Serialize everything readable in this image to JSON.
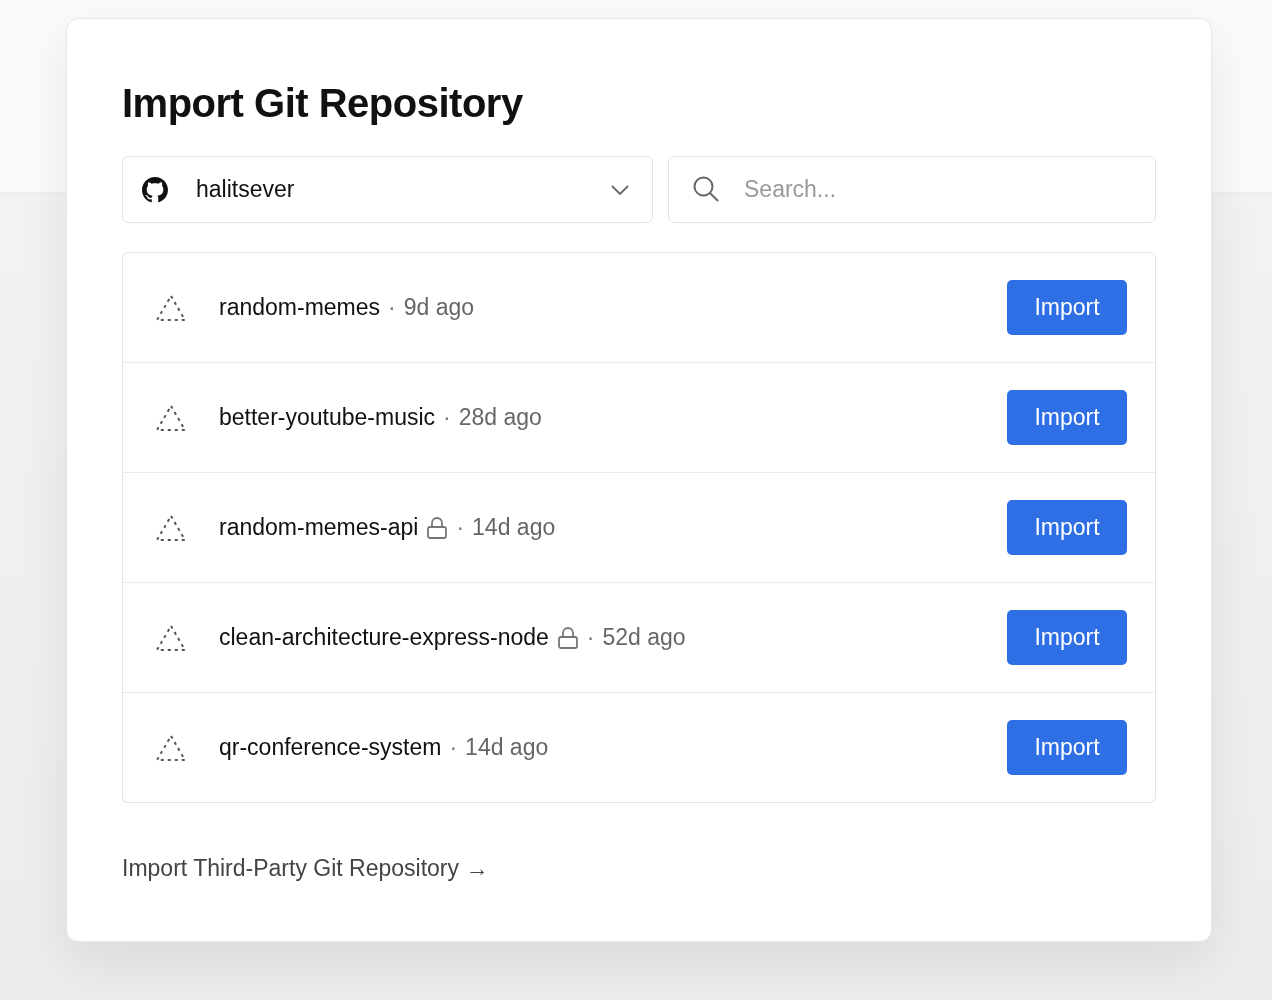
{
  "title": "Import Git Repository",
  "account_select": {
    "value": "halitsever"
  },
  "search": {
    "placeholder": "Search..."
  },
  "repositories": [
    {
      "name": "random-memes",
      "private": false,
      "separator": "·",
      "updated": "9d ago",
      "button": "Import"
    },
    {
      "name": "better-youtube-music",
      "private": false,
      "separator": "·",
      "updated": "28d ago",
      "button": "Import"
    },
    {
      "name": "random-memes-api",
      "private": true,
      "separator": "·",
      "updated": "14d ago",
      "button": "Import"
    },
    {
      "name": "clean-architecture-express-node",
      "private": true,
      "separator": "·",
      "updated": "52d ago",
      "button": "Import"
    },
    {
      "name": "qr-conference-system",
      "private": false,
      "separator": "·",
      "updated": "14d ago",
      "button": "Import"
    }
  ],
  "third_party_link": "Import Third-Party Git Repository →"
}
